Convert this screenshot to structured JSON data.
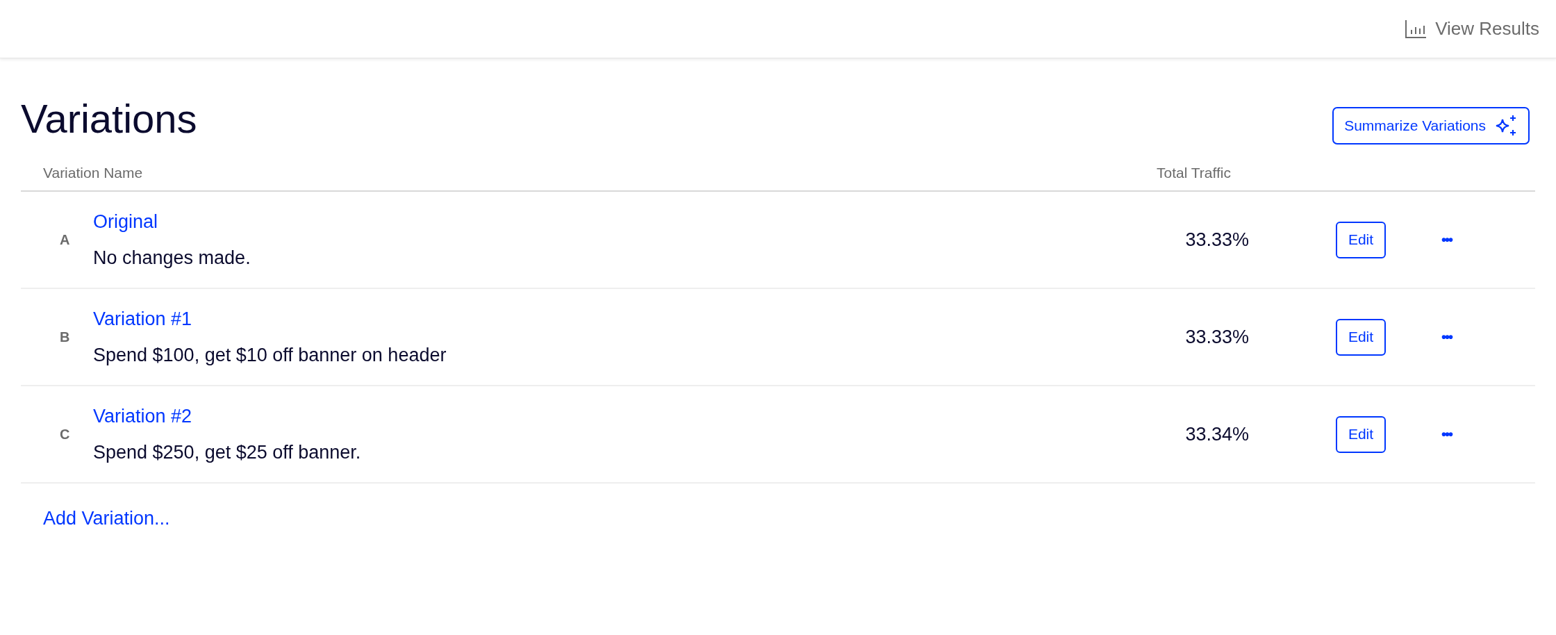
{
  "header": {
    "view_results": "View Results"
  },
  "title": "Variations",
  "summarize_button": "Summarize Variations",
  "table": {
    "columns": [
      "Variation Name",
      "Total Traffic"
    ],
    "rows": [
      {
        "letter": "A",
        "name": "Original",
        "description": "No changes made.",
        "traffic": "33.33%",
        "edit": "Edit",
        "more": "•••"
      },
      {
        "letter": "B",
        "name": "Variation #1",
        "description": "Spend $100, get $10 off banner on header",
        "traffic": "33.33%",
        "edit": "Edit",
        "more": "•••"
      },
      {
        "letter": "C",
        "name": "Variation #2",
        "description": "Spend $250, get $25 off banner.",
        "traffic": "33.34%",
        "edit": "Edit",
        "more": "•••"
      }
    ]
  },
  "add_variation": "Add Variation..."
}
